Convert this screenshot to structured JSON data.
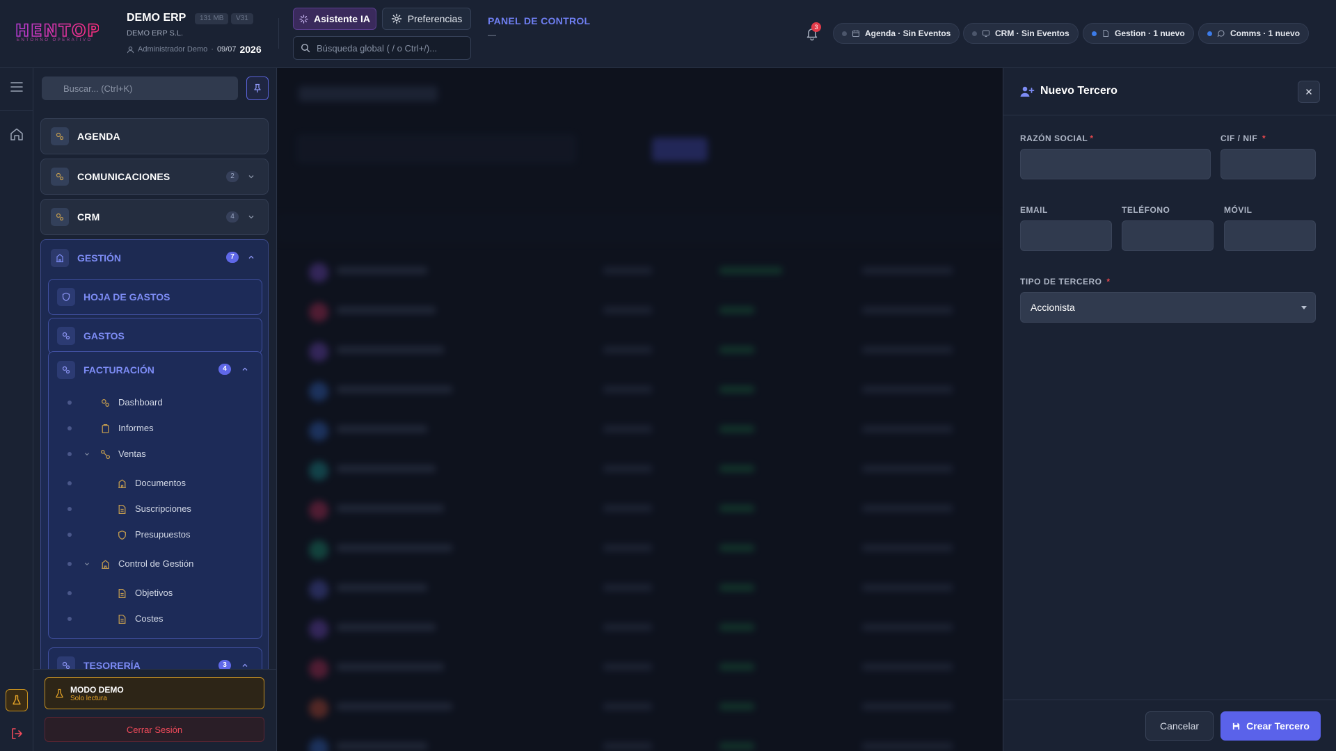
{
  "brand": {
    "logo_text": "HENTOP",
    "tagline": "ENTORNO OPERATIVO",
    "accent": "#e5338f"
  },
  "company": {
    "name": "DEMO ERP",
    "size": "131 MB",
    "version": "V31",
    "legal_name": "DEMO ERP S.L.",
    "user": "Administrador Demo",
    "date": "09/07",
    "year": "2026"
  },
  "toolbar": {
    "ai_label": "Asistente IA",
    "prefs_label": "Preferencias",
    "search_placeholder": "Búsqueda global ( / o Ctrl+/)...",
    "panel_title": "PANEL DE CONTROL",
    "panel_sub": "—"
  },
  "notifications": {
    "count": "3"
  },
  "chips": [
    {
      "label": "Agenda · Sin Eventos",
      "icon": "calendar-icon"
    },
    {
      "label": "CRM · Sin Eventos",
      "icon": "monitor-icon"
    },
    {
      "label": "Gestion · 1 nuevo",
      "icon": "document-icon"
    },
    {
      "label": "Comms · 1 nuevo",
      "icon": "chat-icon"
    }
  ],
  "sidebar": {
    "search_placeholder": "Buscar... (Ctrl+K)",
    "sections": [
      {
        "label": "AGENDA"
      },
      {
        "label": "COMUNICACIONES",
        "badge": "2"
      },
      {
        "label": "CRM",
        "badge": "4"
      }
    ],
    "gestion": {
      "label": "GESTIÓN",
      "badge": "7",
      "subsections": [
        {
          "label": "HOJA DE GASTOS"
        },
        {
          "label": "GASTOS"
        }
      ],
      "facturacion": {
        "label": "FACTURACIÓN",
        "badge": "4",
        "items": [
          {
            "label": "Dashboard"
          },
          {
            "label": "Informes"
          },
          {
            "label": "Ventas"
          },
          {
            "label": "Documentos"
          },
          {
            "label": "Suscripciones"
          },
          {
            "label": "Presupuestos"
          },
          {
            "label": "Control de Gestión"
          },
          {
            "label": "Objetivos"
          },
          {
            "label": "Costes"
          }
        ]
      },
      "tesoreria": {
        "label": "TESORERÍA",
        "badge": "3"
      }
    },
    "demo": {
      "title": "MODO DEMO",
      "subtitle": "Solo lectura"
    },
    "logout": "Cerrar Sesión"
  },
  "drawer": {
    "title": "Nuevo Tercero",
    "fields": {
      "razon_social": {
        "label": "RAZÓN SOCIAL",
        "value": ""
      },
      "cif": {
        "label": "CIF / NIF",
        "value": ""
      },
      "email": {
        "label": "EMAIL",
        "value": ""
      },
      "telefono": {
        "label": "TELÉFONO",
        "value": ""
      },
      "movil": {
        "label": "MÓVIL",
        "value": ""
      },
      "tipo": {
        "label": "TIPO DE TERCERO",
        "value": "Accionista"
      }
    },
    "cancel": "Cancelar",
    "create": "Crear Tercero"
  },
  "colors": {
    "primary": "#5a62ea",
    "sidebar_active": "#7d8cf5",
    "danger": "#ef4a5a",
    "warning": "#e3a227"
  }
}
